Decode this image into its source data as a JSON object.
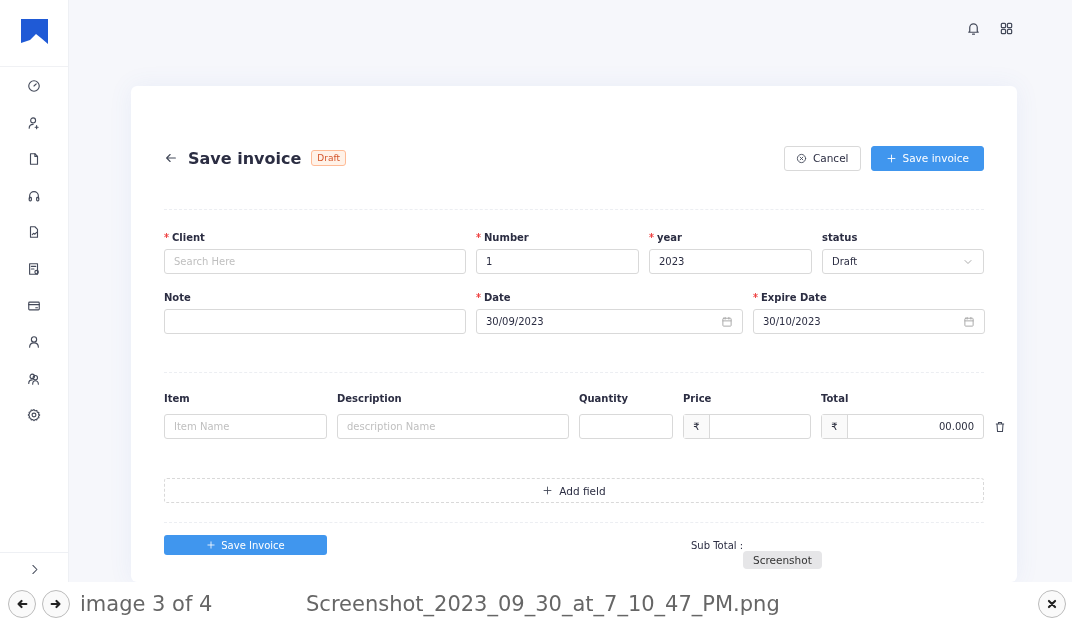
{
  "page": {
    "title": "Save invoice",
    "badge": "Draft",
    "buttons": [
      {
        "label": "Cancel",
        "kind": "secondary"
      },
      {
        "label": "Save invoice",
        "kind": "primary"
      }
    ],
    "form_rows": [
      [
        {
          "label": "Client",
          "required": true,
          "placeholder": "Search Here",
          "kind": "text"
        },
        {
          "label": "Number",
          "required": true,
          "value": "1",
          "kind": "text"
        },
        {
          "label": "year",
          "required": true,
          "value": "2023",
          "kind": "text"
        },
        {
          "label": "status",
          "required": false,
          "value": "Draft",
          "kind": "select"
        }
      ],
      [
        {
          "label": "Note",
          "required": false,
          "kind": "text"
        },
        {
          "label": "Date",
          "required": true,
          "value": "30/09/2023",
          "kind": "date"
        },
        {
          "label": "Expire Date",
          "required": true,
          "value": "30/10/2023",
          "kind": "date"
        }
      ]
    ],
    "items": {
      "columns": [
        "Item",
        "Description",
        "Quantity",
        "Price",
        "Total"
      ],
      "row": {
        "item_placeholder": "Item Name",
        "description_placeholder": "description Name",
        "price_currency": "₹",
        "total_currency": "₹",
        "total": "00.000"
      }
    },
    "add_field": "Add field",
    "footer": {
      "save_button": "Save Invoice",
      "subtotal_label": "Sub Total :"
    }
  },
  "viewer": {
    "tooltip": "Screenshot",
    "counter": "image 3 of 4",
    "filename": "Screenshot_2023_09_30_at_7_10_47_PM.png"
  }
}
